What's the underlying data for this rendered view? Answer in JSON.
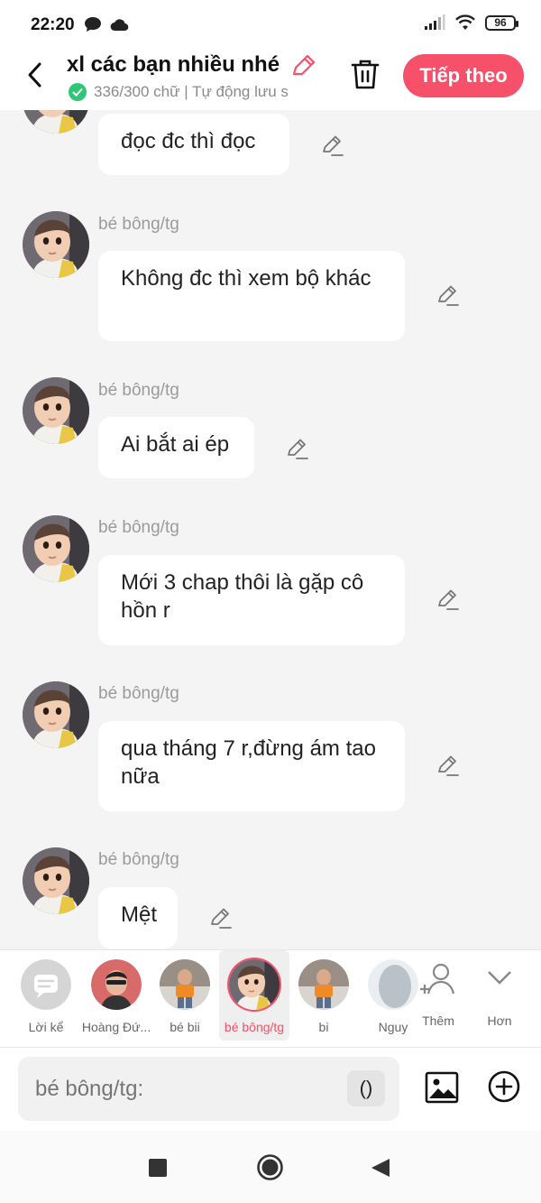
{
  "status_bar": {
    "time": "22:20",
    "battery": "96"
  },
  "header": {
    "title": "xl các bạn nhiều nhé",
    "word_count": "336/300 chữ | Tự động lưu s",
    "next_label": "Tiếp theo"
  },
  "messages": [
    {
      "sender": "",
      "text": "đọc đc thì đọc"
    },
    {
      "sender": "bé bông/tg",
      "text": "Không đc thì xem bộ khác"
    },
    {
      "sender": "bé bông/tg",
      "text": "Ai bắt ai ép"
    },
    {
      "sender": "bé bông/tg",
      "text": "Mới 3 chap thôi là gặp cô hồn r"
    },
    {
      "sender": "bé bông/tg",
      "text": "qua tháng 7 r,đừng ám tao nữa"
    },
    {
      "sender": "bé bông/tg",
      "text": "Mệt"
    }
  ],
  "characters": [
    {
      "name": "Lời kể"
    },
    {
      "name": "Hoàng Đứ..."
    },
    {
      "name": "bé bii"
    },
    {
      "name": "bé bông/tg",
      "selected": true
    },
    {
      "name": "bi"
    },
    {
      "name": "Nguy"
    },
    {
      "name": "Thêm"
    },
    {
      "name": "Hơn"
    }
  ],
  "input": {
    "placeholder": "bé bông/tg:",
    "paren_label": "()"
  },
  "colors": {
    "accent": "#f6506a",
    "check": "#2ec776"
  }
}
